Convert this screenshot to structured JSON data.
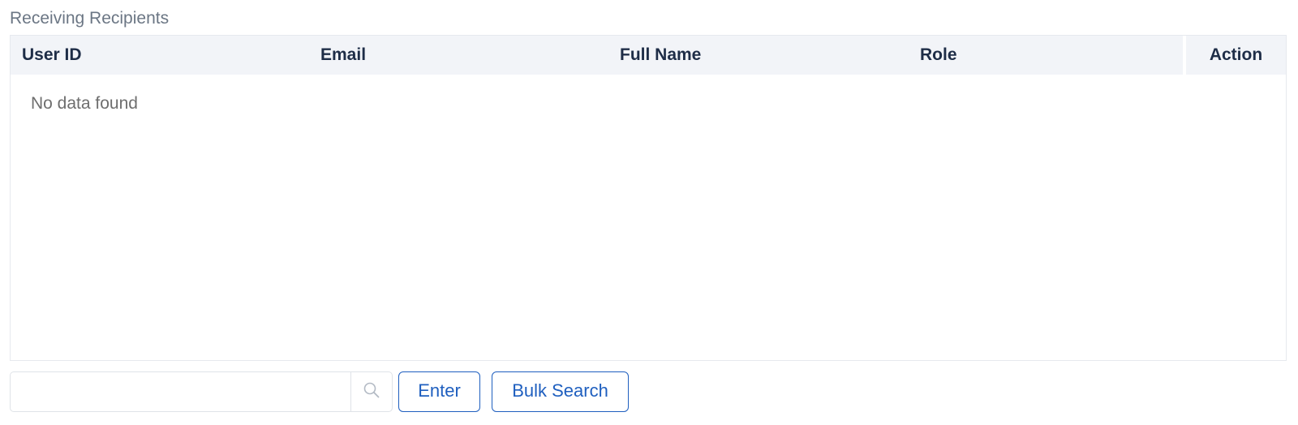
{
  "section": {
    "title": "Receiving Recipients"
  },
  "table": {
    "columns": [
      "User ID",
      "Email",
      "Full Name",
      "Role"
    ],
    "action_header": "Action",
    "rows": [],
    "empty_message": "No data found"
  },
  "search": {
    "value": "",
    "placeholder": "",
    "icon": "search-icon"
  },
  "buttons": {
    "enter_label": "Enter",
    "bulk_search_label": "Bulk Search"
  },
  "colors": {
    "header_bg": "#f2f4f8",
    "header_text": "#1e2d47",
    "accent": "#1f5fbf",
    "muted_text": "#6e6e6e"
  }
}
